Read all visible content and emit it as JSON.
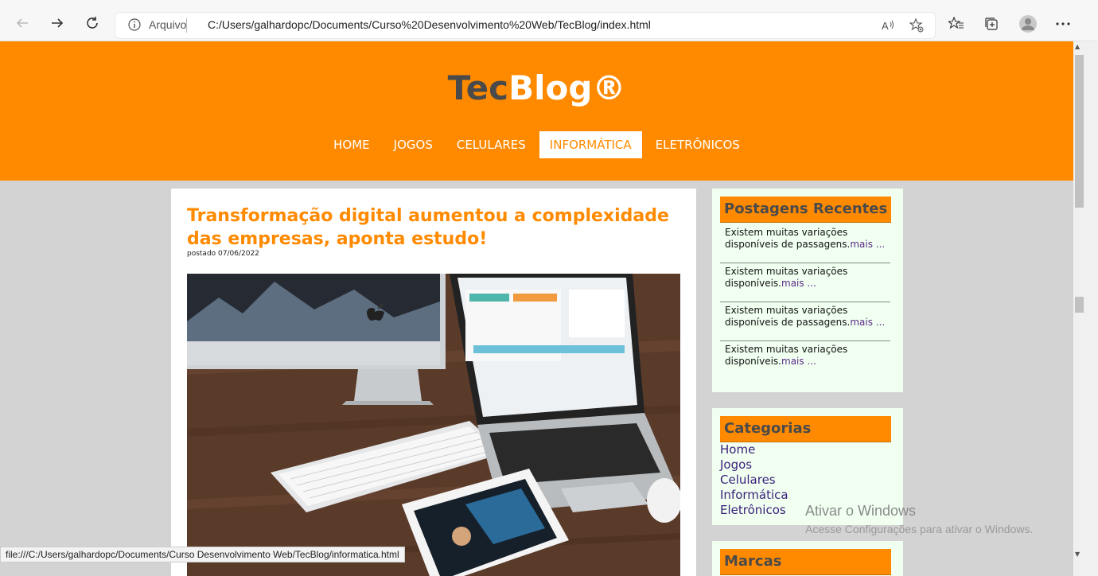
{
  "browser": {
    "address_label": "Arquivo",
    "url": "C:/Users/galhardopc/Documents/Curso%20Desenvolvimento%20Web/TecBlog/index.html",
    "status_url": "file:///C:/Users/galhardopc/Documents/Curso Desenvolvimento Web/TecBlog/informatica.html"
  },
  "site": {
    "logo_tec": "Tec",
    "logo_blog": "Blog®",
    "menu": [
      "HOME",
      "JOGOS",
      "CELULARES",
      "INFORMÁTICA",
      "ELETRÔNICOS"
    ],
    "active_menu": "INFORMÁTICA"
  },
  "article": {
    "title": "Transformação digital aumentou a complexidade das empresas, aponta estudo!",
    "date": "postado 07/06/2022"
  },
  "recent": {
    "heading": "Postagens Recentes",
    "posts": [
      {
        "text": "Existem muitas variações disponíveis de passagens.",
        "more": "mais ..."
      },
      {
        "text": "Existem muitas variações disponíveis.",
        "more": "mais ..."
      },
      {
        "text": "Existem muitas variações disponíveis de passagens.",
        "more": "mais ..."
      },
      {
        "text": "Existem muitas variações disponíveis.",
        "more": "mais ..."
      }
    ]
  },
  "categories": {
    "heading": "Categorias",
    "items": [
      "Home",
      "Jogos",
      "Celulares",
      "Informática",
      "Eletrônicos"
    ]
  },
  "brands": {
    "heading": "Marcas"
  },
  "windows_watermark": {
    "line1": "Ativar o Windows",
    "line2": "Acesse Configurações para ativar o Windows."
  },
  "colors": {
    "header": "#ff8a00",
    "page_bg": "#d3d3d3",
    "sidebar_bg": "#f0fff0",
    "link": "#3a1f7a"
  }
}
